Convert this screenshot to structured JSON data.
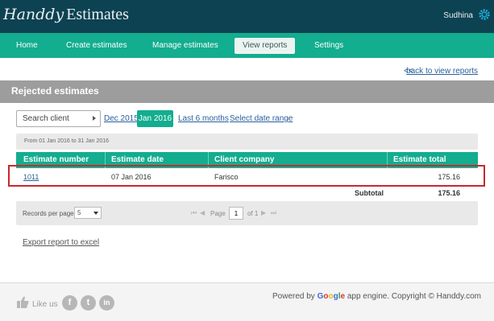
{
  "header": {
    "logo_script": "Handdy",
    "logo_text": "Estimates",
    "user": "Sudhina"
  },
  "nav": [
    {
      "label": "Home"
    },
    {
      "label": "Create estimates"
    },
    {
      "label": "Manage estimates"
    },
    {
      "label": "View reports",
      "active": true
    },
    {
      "label": "Settings"
    }
  ],
  "back_link": {
    "arrow": "<<",
    "label": "back to view reports"
  },
  "panel_title": "Rejected estimates",
  "filters": {
    "search_placeholder": "Search client",
    "prev_month": "Dec 2015",
    "current_month": "Jan 2016",
    "last_6": "Last 6 months",
    "date_range": "Select date range",
    "arrow": "›"
  },
  "range_text": "From 01 Jan 2016 to 31 Jan 2016",
  "table": {
    "headers": [
      "Estimate number",
      "Estimate date",
      "Client company",
      "Estimate total"
    ],
    "rows": [
      {
        "number": "1011",
        "date": "07 Jan 2016",
        "client": "Farisco",
        "total": "175.16"
      }
    ],
    "subtotal_label": "Subtotal",
    "subtotal_value": "175.16"
  },
  "pager": {
    "records_label": "Records per page",
    "per_page": "5",
    "page_label": "Page",
    "page": "1",
    "of_label": "of 1"
  },
  "export_label": "Export report to excel",
  "footer": {
    "like_label": "Like us",
    "social": [
      "f",
      "t",
      "in"
    ],
    "powered_prefix": "Powered by",
    "google_letters": [
      "G",
      "o",
      "o",
      "g",
      "l",
      "e"
    ],
    "google_colors": [
      "#3b6ed6",
      "#d6382e",
      "#e8b320",
      "#3b6ed6",
      "#2d9c45",
      "#d6382e"
    ],
    "powered_suffix": "app engine. Copyright © Handdy.com"
  },
  "colors": {
    "brand_dark": "#0d4252",
    "accent": "#13ad8f",
    "highlight": "#c8282e"
  }
}
